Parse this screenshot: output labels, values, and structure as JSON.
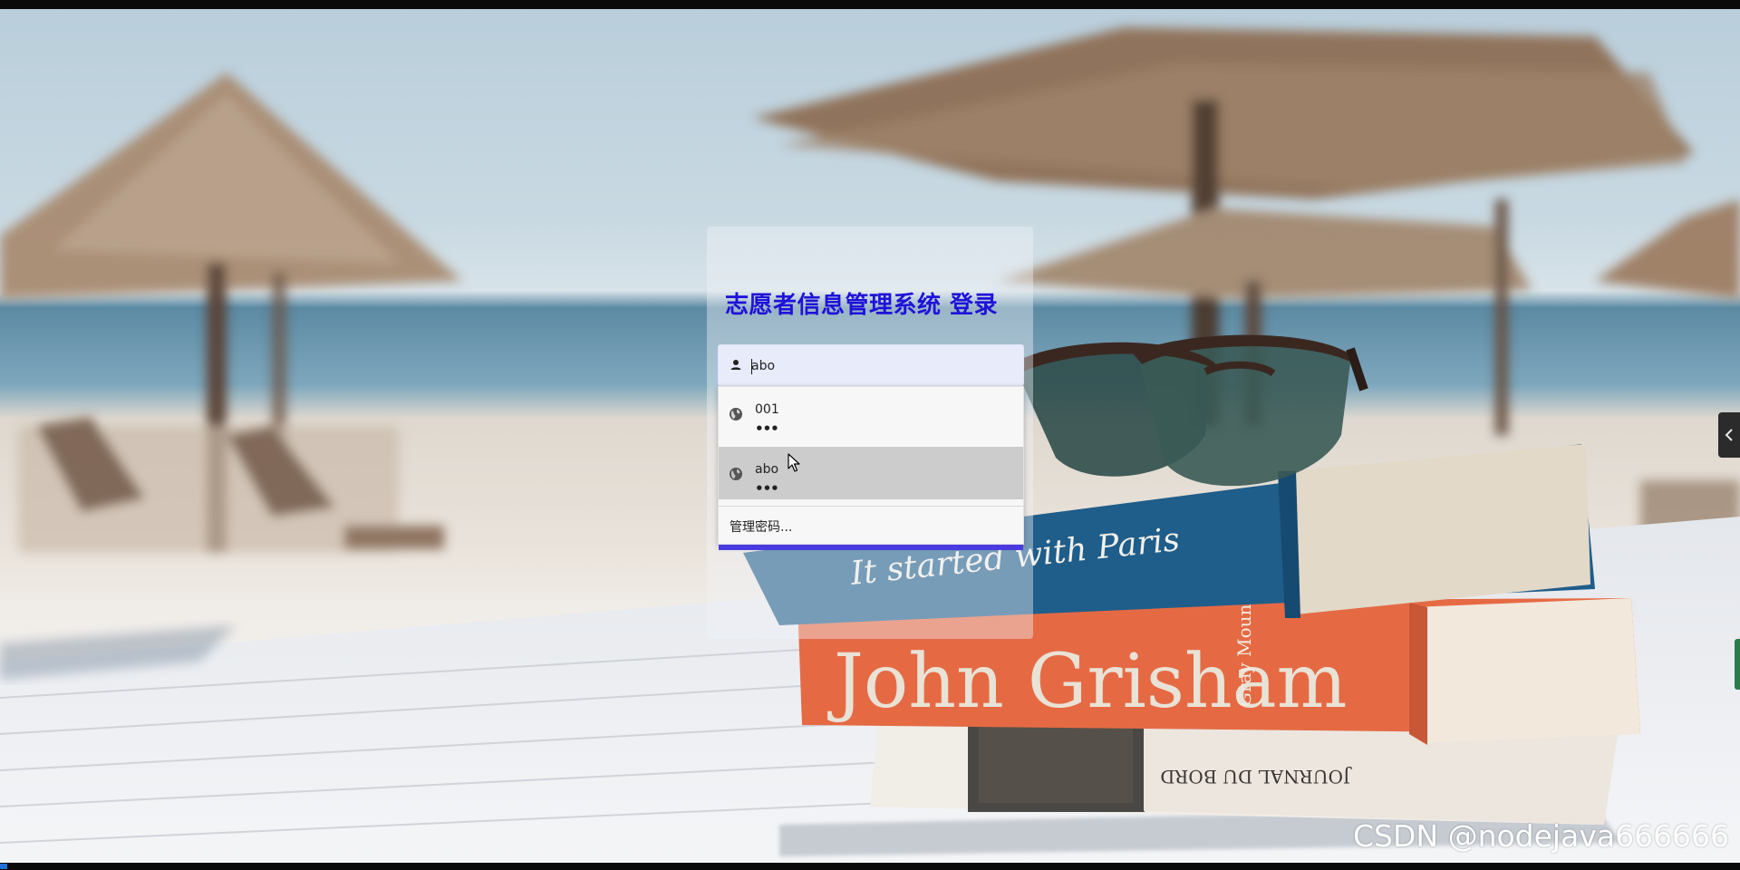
{
  "login": {
    "title": "志愿者信息管理系统 登录",
    "username_value": "abo"
  },
  "autofill": {
    "items": [
      {
        "username": "001",
        "password_mask": "•••"
      },
      {
        "username": "abo",
        "password_mask": "•••"
      }
    ],
    "manage_label": "管理密码..."
  },
  "watermark": "CSDN @nodejava666666",
  "colors": {
    "title": "#1f12d9",
    "field_bg": "#e8ecfa",
    "highlight_row": "#cccccc",
    "accent_bar": "#4a3be0"
  },
  "icons": {
    "username": "user-icon",
    "credential": "globe-icon",
    "side_toggle": "chevron-left-icon",
    "pointer": "mouse-cursor-icon"
  }
}
